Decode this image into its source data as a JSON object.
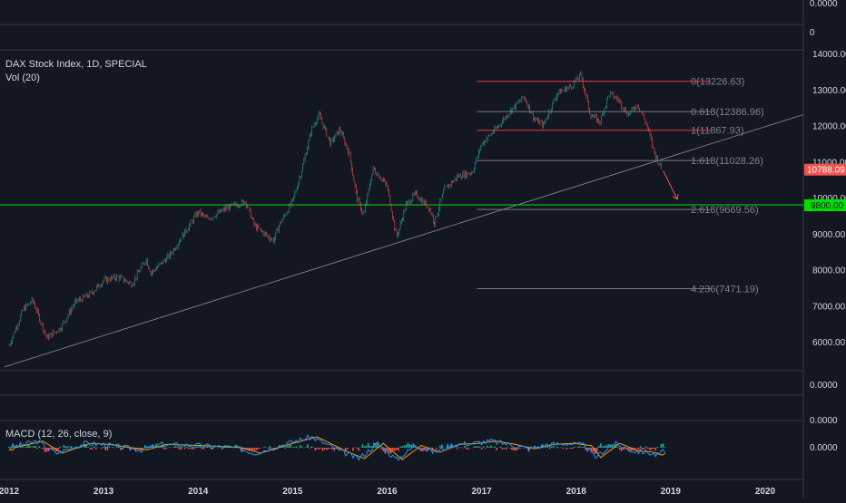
{
  "header": {
    "title": "DAX Stock Index, 1D, SPECIAL",
    "volume": "Vol (20)",
    "macd": "MACD (12, 26, close, 9)"
  },
  "colors": {
    "background": "#131722",
    "up": "#26a69a",
    "down": "#ef5350",
    "fib_line": "#787b86",
    "red_level": "#f23645",
    "support": "#00e000",
    "trend": "#8a8e99",
    "macd_line": "#2196f3",
    "signal_line": "#ff9800"
  },
  "chart_data": {
    "type": "candlestick",
    "x_ticks": [
      "2012",
      "2013",
      "2014",
      "2015",
      "2016",
      "2017",
      "2018",
      "2019",
      "2020"
    ],
    "y_ticks": [
      "14000.00",
      "13000.00",
      "12000.00",
      "11000.00",
      "10000.00",
      "9000.00",
      "8000.00",
      "7000.00",
      "6000.00"
    ],
    "ylim": [
      5200,
      14200
    ],
    "xlim": [
      2012.0,
      2020.4
    ],
    "top_pane_tick": "0.0000",
    "top_pane_tick2": "0",
    "vol_pane_tick": "0.0000",
    "vol_pane_tick2": "0.0000",
    "macd_tick": "0.0000",
    "last_price": {
      "label": "10788.09",
      "value": 10788.09
    },
    "support_level": {
      "label": "9800.00",
      "value": 9800
    },
    "trendline": {
      "start": [
        2011.95,
        5300
      ],
      "end": [
        2020.4,
        12300
      ]
    },
    "fib_levels": [
      {
        "label": "0(13226.63)",
        "value": 13226.63,
        "red": true
      },
      {
        "label": "0.618(12386.96)",
        "value": 12386.96,
        "red": false
      },
      {
        "label": "1(11867.93)",
        "value": 11867.93,
        "red": true
      },
      {
        "label": "1.618(11028.26)",
        "value": 11028.26,
        "red": false
      },
      {
        "label": "2.618(9669.56)",
        "value": 9669.56,
        "red": false
      },
      {
        "label": "4.236(7471.19)",
        "value": 7471.19,
        "red": false
      }
    ],
    "fib_x_start": 2016.95,
    "price_path": [
      [
        2012.0,
        5900
      ],
      [
        2012.15,
        6900
      ],
      [
        2012.25,
        7150
      ],
      [
        2012.4,
        6100
      ],
      [
        2012.55,
        6400
      ],
      [
        2012.7,
        7100
      ],
      [
        2012.85,
        7300
      ],
      [
        2013.0,
        7700
      ],
      [
        2013.15,
        7800
      ],
      [
        2013.3,
        7600
      ],
      [
        2013.45,
        8300
      ],
      [
        2013.5,
        7900
      ],
      [
        2013.7,
        8400
      ],
      [
        2013.85,
        9000
      ],
      [
        2014.0,
        9600
      ],
      [
        2014.1,
        9400
      ],
      [
        2014.3,
        9700
      ],
      [
        2014.5,
        9900
      ],
      [
        2014.6,
        9200
      ],
      [
        2014.8,
        8800
      ],
      [
        2014.85,
        9200
      ],
      [
        2015.0,
        9900
      ],
      [
        2015.1,
        10800
      ],
      [
        2015.2,
        11900
      ],
      [
        2015.28,
        12300
      ],
      [
        2015.4,
        11500
      ],
      [
        2015.5,
        11900
      ],
      [
        2015.6,
        11200
      ],
      [
        2015.68,
        10000
      ],
      [
        2015.75,
        9500
      ],
      [
        2015.85,
        10800
      ],
      [
        2015.95,
        10500
      ],
      [
        2016.0,
        10300
      ],
      [
        2016.1,
        8900
      ],
      [
        2016.2,
        9800
      ],
      [
        2016.3,
        10100
      ],
      [
        2016.45,
        9700
      ],
      [
        2016.5,
        9300
      ],
      [
        2016.6,
        10200
      ],
      [
        2016.75,
        10600
      ],
      [
        2016.9,
        10700
      ],
      [
        2017.0,
        11500
      ],
      [
        2017.15,
        11900
      ],
      [
        2017.3,
        12400
      ],
      [
        2017.45,
        12800
      ],
      [
        2017.55,
        12200
      ],
      [
        2017.65,
        12000
      ],
      [
        2017.8,
        12900
      ],
      [
        2017.95,
        13100
      ],
      [
        2018.05,
        13400
      ],
      [
        2018.15,
        12300
      ],
      [
        2018.25,
        12100
      ],
      [
        2018.35,
        12900
      ],
      [
        2018.45,
        12700
      ],
      [
        2018.55,
        12300
      ],
      [
        2018.65,
        12600
      ],
      [
        2018.75,
        12000
      ],
      [
        2018.82,
        11300
      ],
      [
        2018.9,
        10800
      ]
    ],
    "projection_arrow": {
      "from": [
        2018.92,
        10750
      ],
      "to": [
        2019.07,
        9950
      ]
    },
    "macd_path": [
      [
        2012.0,
        0
      ],
      [
        2012.3,
        0.6
      ],
      [
        2012.5,
        -0.5
      ],
      [
        2012.8,
        0.4
      ],
      [
        2013.0,
        0.3
      ],
      [
        2013.4,
        -0.2
      ],
      [
        2013.6,
        0.3
      ],
      [
        2014.0,
        0.2
      ],
      [
        2014.4,
        0.0
      ],
      [
        2014.6,
        -0.5
      ],
      [
        2014.9,
        0.3
      ],
      [
        2015.2,
        1.0
      ],
      [
        2015.5,
        -0.3
      ],
      [
        2015.7,
        -1.0
      ],
      [
        2015.9,
        0.4
      ],
      [
        2016.1,
        -1.1
      ],
      [
        2016.3,
        0.2
      ],
      [
        2016.5,
        -0.4
      ],
      [
        2016.7,
        0.3
      ],
      [
        2016.9,
        0.4
      ],
      [
        2017.1,
        0.6
      ],
      [
        2017.3,
        0.3
      ],
      [
        2017.5,
        -0.1
      ],
      [
        2017.7,
        0.3
      ],
      [
        2017.9,
        0.4
      ],
      [
        2018.1,
        0.2
      ],
      [
        2018.2,
        -0.9
      ],
      [
        2018.4,
        0.4
      ],
      [
        2018.6,
        -0.3
      ],
      [
        2018.75,
        -0.4
      ],
      [
        2018.85,
        -0.7
      ],
      [
        2018.95,
        -0.2
      ]
    ]
  }
}
